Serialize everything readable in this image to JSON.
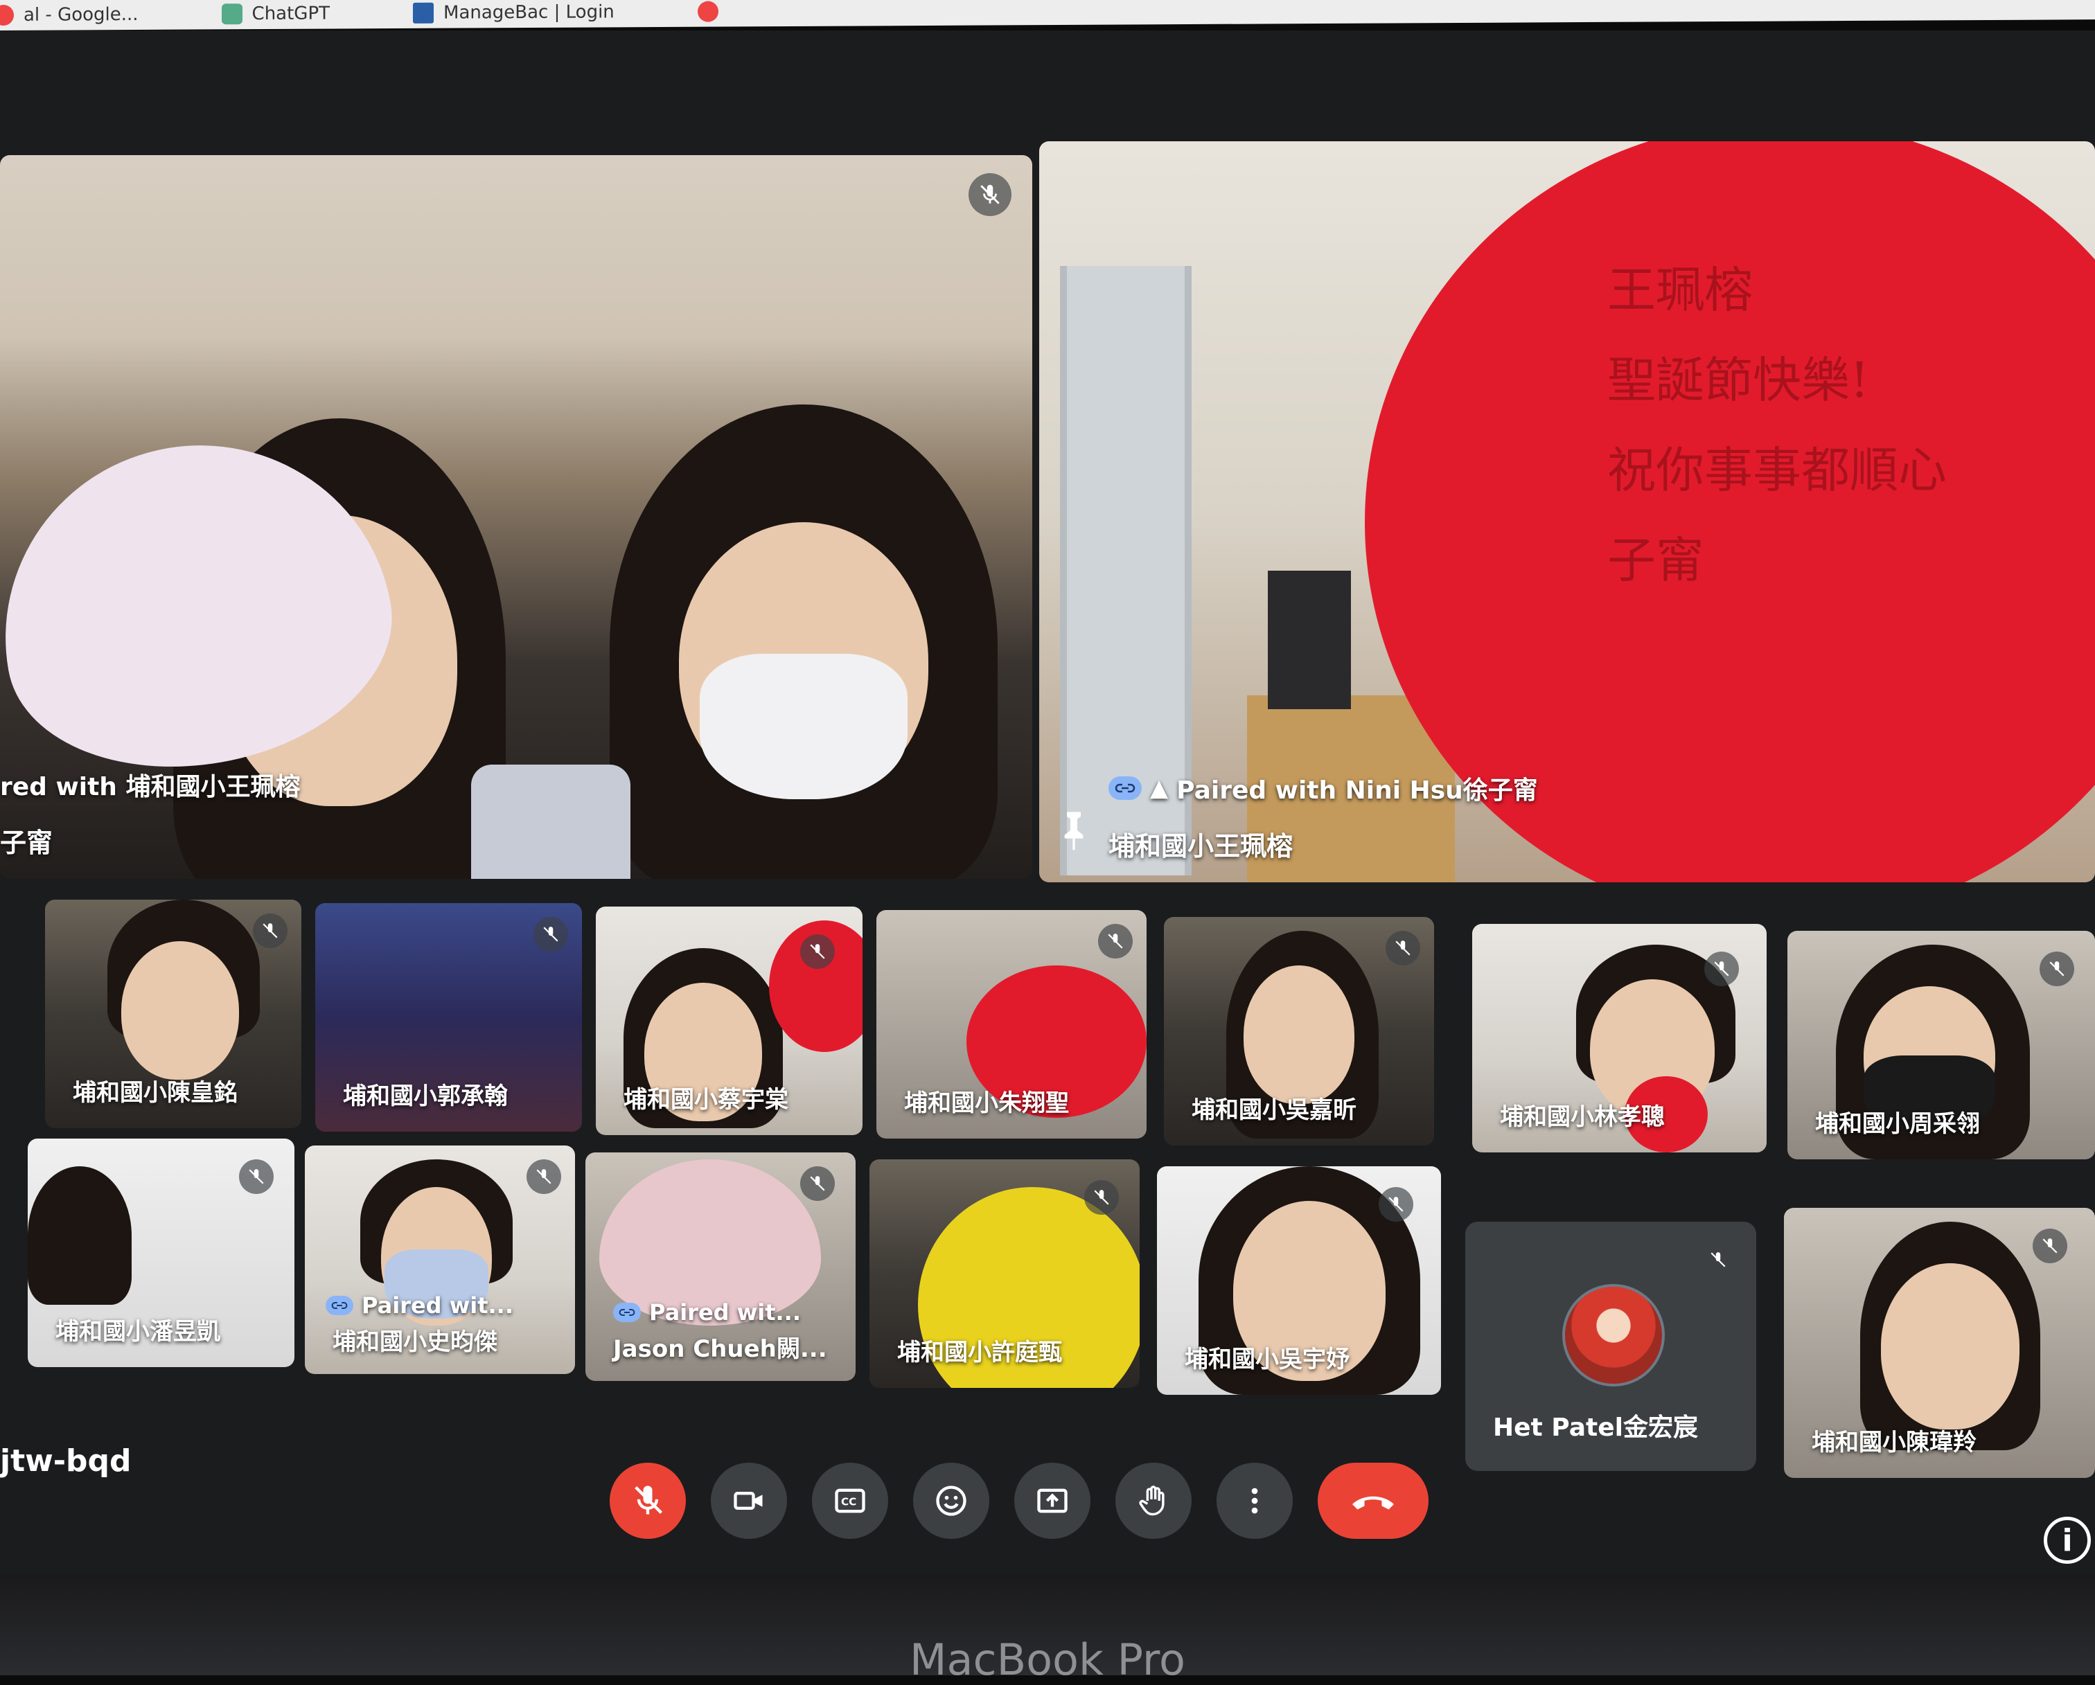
{
  "bookmarks": [
    {
      "label": "al - Google...",
      "icon": "google-icon"
    },
    {
      "label": "ChatGPT",
      "icon": "chatgpt-icon"
    },
    {
      "label": "ManageBac | Login",
      "icon": "managebac-icon"
    },
    {
      "label": "",
      "icon": "bookmark-icon"
    }
  ],
  "meeting": {
    "code": "jtw-bqd",
    "info_icon": "info-icon"
  },
  "featured": [
    {
      "paired": "red with 埔和國小王珮榕",
      "name": "子甯"
    },
    {
      "paired": "Paired with Nini Hsu徐子甯",
      "name": "埔和國小王珮榕",
      "card_text": "王珮榕\n聖誕節快樂!\n祝你事事都順心\n子甯"
    }
  ],
  "tiles_row1": [
    {
      "name": "埔和國小陳皇銘"
    },
    {
      "name": "埔和國小郭承翰"
    },
    {
      "name": "埔和國小蔡宇棠"
    },
    {
      "name": "埔和國小朱翔聖"
    },
    {
      "name": "埔和國小吳嘉昕"
    },
    {
      "name": "埔和國小林孝聰"
    },
    {
      "name": "埔和國小周采翎"
    }
  ],
  "tiles_row2": [
    {
      "name": "埔和國小潘昱凱",
      "paired": ""
    },
    {
      "name": "埔和國小史昀傑",
      "paired": "Paired wit..."
    },
    {
      "name": "Jason Chueh闕...",
      "paired": "Paired wit..."
    },
    {
      "name": "埔和國小許庭甄",
      "paired": ""
    },
    {
      "name": "埔和國小吳宇妤",
      "paired": ""
    },
    {
      "name": "Het Patel金宏宸",
      "paired": ""
    },
    {
      "name": "埔和國小陳瑋羚",
      "paired": ""
    }
  ],
  "controls": [
    {
      "name": "mic-off-button",
      "icon": "mic-off-icon",
      "color": "#ea4335"
    },
    {
      "name": "camera-button",
      "icon": "camera-icon",
      "color": "#3c4043"
    },
    {
      "name": "captions-button",
      "icon": "cc-icon",
      "color": "#3c4043"
    },
    {
      "name": "reactions-button",
      "icon": "emoji-icon",
      "color": "#3c4043"
    },
    {
      "name": "present-button",
      "icon": "present-icon",
      "color": "#3c4043"
    },
    {
      "name": "raise-hand-button",
      "icon": "hand-icon",
      "color": "#3c4043"
    },
    {
      "name": "more-options-button",
      "icon": "more-vert-icon",
      "color": "#3c4043"
    },
    {
      "name": "leave-call-button",
      "icon": "hang-up-icon",
      "color": "#ea4335"
    }
  ],
  "device": {
    "label": "MacBook Pro"
  }
}
